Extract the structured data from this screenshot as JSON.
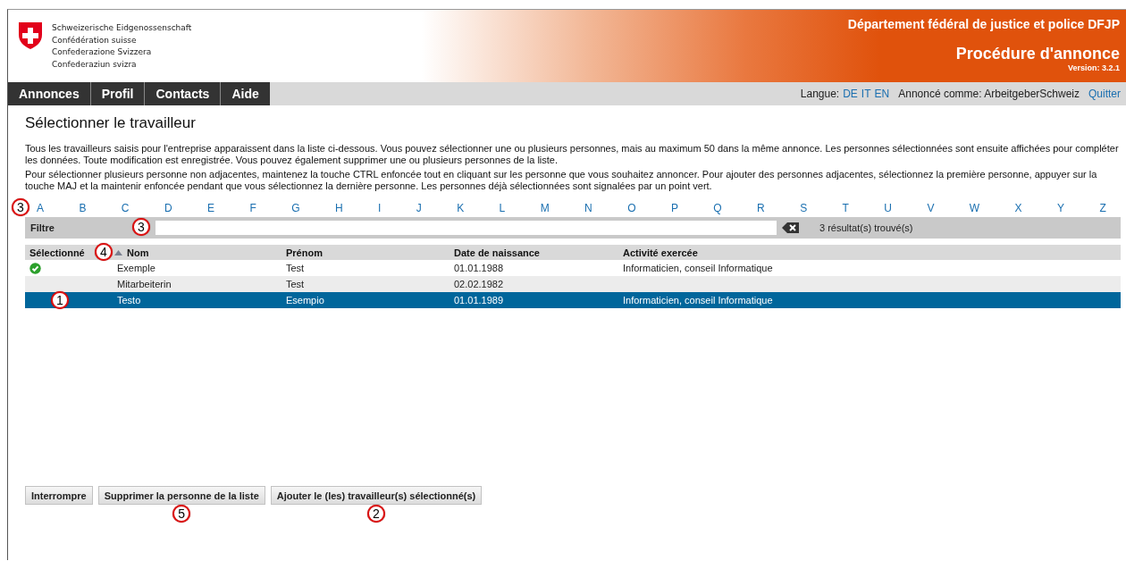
{
  "header": {
    "federation_names": [
      "Schweizerische Eidgenossenschaft",
      "Confédération suisse",
      "Confederazione Svizzera",
      "Confederaziun svizra"
    ],
    "department": "Département fédéral de justice et police DFJP",
    "app_title": "Procédure d'annonce",
    "version": "Version: 3.2.1"
  },
  "nav": {
    "tabs": [
      {
        "label": "Annonces"
      },
      {
        "label": "Profil"
      },
      {
        "label": "Contacts"
      },
      {
        "label": "Aide"
      }
    ]
  },
  "user_bar": {
    "language_label": "Langue:",
    "languages": [
      "DE",
      "IT",
      "EN"
    ],
    "logged_in_as": "Annoncé comme: ArbeitgeberSchweiz",
    "quit_link": "Quitter"
  },
  "page": {
    "title": "Sélectionner le travailleur",
    "paragraphs": [
      "Tous les travailleurs saisis pour l'entreprise apparaissent dans la liste ci-dessous. Vous pouvez sélectionner une ou plusieurs personnes, mais au maximum 50 dans la même annonce. Les personnes sélectionnées sont ensuite affichées pour compléter les données. Toute modification est enregistrée. Vous pouvez également supprimer une ou plusieurs personnes de la liste.",
      "Pour sélectionner plusieurs personne non adjacentes, maintenez la touche CTRL enfoncée tout en cliquant sur les personne que vous souhaitez annoncer. Pour ajouter des personnes adjacentes, sélectionnez la première personne, appuyer sur la touche MAJ et la maintenir enfoncée pendant que vous sélectionnez la dernière personne. Les personnes déjà sélectionnées sont signalées par un point vert."
    ]
  },
  "alphabet": {
    "callout": "3",
    "letters": [
      "A",
      "B",
      "C",
      "D",
      "E",
      "F",
      "G",
      "H",
      "I",
      "J",
      "K",
      "L",
      "M",
      "N",
      "O",
      "P",
      "Q",
      "R",
      "S",
      "T",
      "U",
      "V",
      "W",
      "X",
      "Y",
      "Z"
    ]
  },
  "filter": {
    "label": "Filtre",
    "callout": "3",
    "result_count": "3 résultat(s) trouvé(s)"
  },
  "table": {
    "callout": "4",
    "columns": [
      {
        "label": "Sélectionné",
        "sorted": false
      },
      {
        "label": "Nom",
        "sorted": true
      },
      {
        "label": "Prénom",
        "sorted": false
      },
      {
        "label": "Date de naissance",
        "sorted": false
      },
      {
        "label": "Activité exercée",
        "sorted": false
      }
    ],
    "rows": [
      {
        "marked": true,
        "selected": false,
        "cells": [
          "",
          "Exemple",
          "Test",
          "01.01.1988",
          "Informaticien, conseil Informatique"
        ]
      },
      {
        "marked": false,
        "selected": false,
        "cells": [
          "",
          "Mitarbeiterin",
          "Test",
          "02.02.1982",
          ""
        ]
      },
      {
        "marked": false,
        "selected": true,
        "callout": "1",
        "cells": [
          "",
          "Testo",
          "Esempio",
          "01.01.1989",
          "Informaticien, conseil Informatique"
        ]
      }
    ]
  },
  "buttons": [
    {
      "label": "Interrompre"
    },
    {
      "label": "Supprimer la personne de la liste",
      "callout": "5"
    },
    {
      "label": "Ajouter le (les) travailleur(s) sélectionné(s)",
      "callout": "2"
    }
  ]
}
